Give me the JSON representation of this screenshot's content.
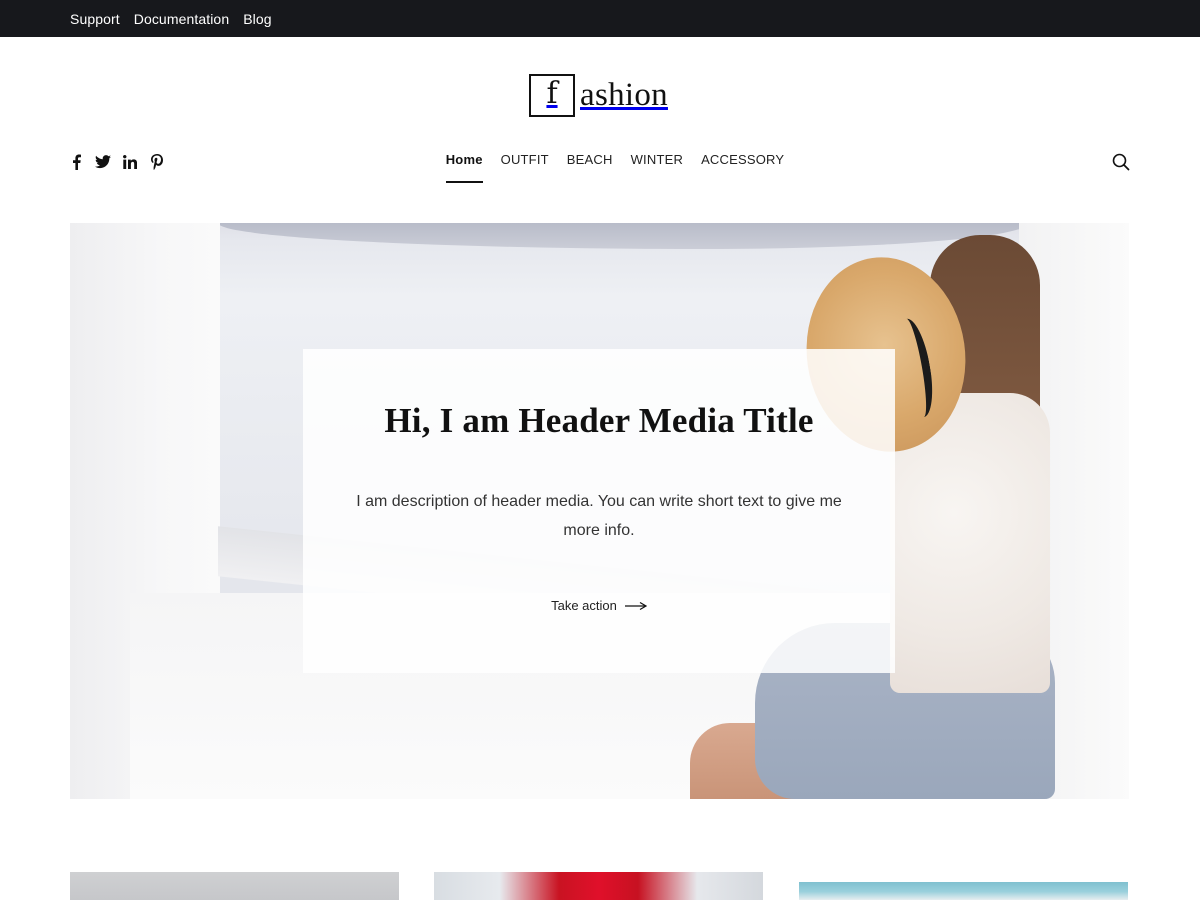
{
  "topbar": {
    "links": [
      "Support",
      "Documentation",
      "Blog"
    ]
  },
  "logo": {
    "boxed_letter": "f",
    "rest": "ashion"
  },
  "social": {
    "icons": [
      "facebook-icon",
      "twitter-icon",
      "linkedin-icon",
      "pinterest-icon"
    ]
  },
  "nav": {
    "items": [
      "Home",
      "OUTFIT",
      "BEACH",
      "WINTER",
      "ACCESSORY"
    ],
    "active": "Home"
  },
  "search": {
    "icon": "search-icon"
  },
  "hero": {
    "title": "Hi, I am Header Media Title",
    "description": "I am description of header media. You can write short text to give me more info.",
    "cta_label": "Take action",
    "cta_icon": "arrow-right-icon"
  },
  "colors": {
    "topbar_bg": "#17181c",
    "text": "#111111"
  }
}
